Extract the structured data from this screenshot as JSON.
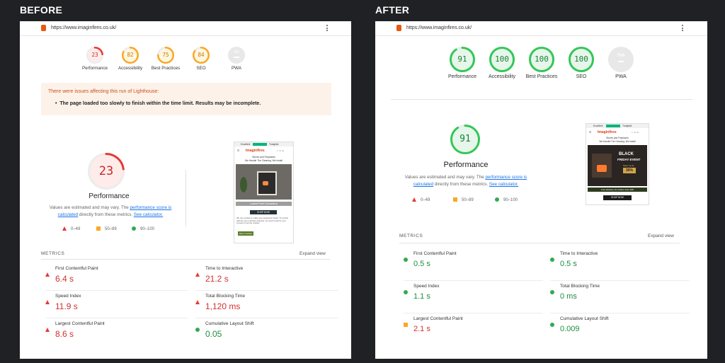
{
  "before": {
    "heading": "BEFORE",
    "url": "https://www.imaginfires.co.uk/",
    "gauges": [
      {
        "score": "23",
        "label": "Performance",
        "value": 23,
        "color": "#e53935",
        "fill": "#fdecea"
      },
      {
        "score": "82",
        "label": "Accessibility",
        "value": 82,
        "color": "#f9a825",
        "fill": "#fff6e0"
      },
      {
        "score": "75",
        "label": "Best Practices",
        "value": 75,
        "color": "#f9a825",
        "fill": "#fff6e0"
      },
      {
        "score": "84",
        "label": "SEO",
        "value": 84,
        "color": "#f9a825",
        "fill": "#fff6e0"
      },
      {
        "score": "PWA",
        "label": "PWA",
        "value": 0,
        "color": "#bdbdbd",
        "fill": "#e8e8e8"
      }
    ],
    "warning_title": "There were issues affecting this run of Lighthouse:",
    "warning_item": "The page loaded too slowly to finish within the time limit. Results may be incomplete.",
    "perf_score": "23",
    "perf_value": 23,
    "perf_title": "Performance",
    "desc_1": "Values are estimated and may vary. The ",
    "desc_link1": "performance score is calculated",
    "desc_2": " directly from these metrics. ",
    "desc_link2": "See calculator.",
    "legend": [
      "0–49",
      "50–89",
      "90–100"
    ],
    "metrics_title": "METRICS",
    "expand_label": "Expand view",
    "metrics": [
      {
        "name": "First Contentful Paint",
        "value": "6.4 s",
        "status": "fail"
      },
      {
        "name": "Time to Interactive",
        "value": "21.2 s",
        "status": "fail"
      },
      {
        "name": "Speed Index",
        "value": "11.9 s",
        "status": "fail"
      },
      {
        "name": "Total Blocking Time",
        "value": "1,120 ms",
        "status": "fail"
      },
      {
        "name": "Largest Contentful Paint",
        "value": "8.6 s",
        "status": "fail"
      },
      {
        "name": "Cumulative Layout Shift",
        "value": "0.05",
        "status": "pass"
      }
    ],
    "shot": {
      "rating": "Excellent",
      "trustpilot": "Trustpilot",
      "brand": "Imaginfires",
      "tagline1": "Stoves and Fireplaces",
      "tagline2": "We Handle The Cleaning, We Install",
      "cta": "Lowest Prices Guaranteed",
      "shop": "SHOP NOW",
      "cookie": "We use cookies to make your experience better. To comply with the new e-Privacy directive, we need to ask for your consent to set the cookies.",
      "cookie_btn": "Allow Cookies"
    }
  },
  "after": {
    "heading": "AFTER",
    "url": "https://www.imaginfires.co.uk/",
    "gauges": [
      {
        "score": "91",
        "label": "Performance",
        "value": 91,
        "color": "#34c759",
        "fill": "#e6f6ea"
      },
      {
        "score": "100",
        "label": "Accessibility",
        "value": 100,
        "color": "#34c759",
        "fill": "#e6f6ea"
      },
      {
        "score": "100",
        "label": "Best Practices",
        "value": 100,
        "color": "#34c759",
        "fill": "#e6f6ea"
      },
      {
        "score": "100",
        "label": "SEO",
        "value": 100,
        "color": "#34c759",
        "fill": "#e6f6ea"
      },
      {
        "score": "PWA",
        "label": "PWA",
        "value": 0,
        "color": "#bdbdbd",
        "fill": "#e8e8e8"
      }
    ],
    "perf_score": "91",
    "perf_value": 91,
    "perf_title": "Performance",
    "desc_1": "Values are estimated and may vary. The ",
    "desc_link1": "performance score is calculated",
    "desc_2": " directly from these metrics. ",
    "desc_link2": "See calculator.",
    "legend": [
      "0–49",
      "50–89",
      "90–100"
    ],
    "metrics_title": "METRICS",
    "expand_label": "Expand view",
    "metrics": [
      {
        "name": "First Contentful Paint",
        "value": "0.5 s",
        "status": "pass"
      },
      {
        "name": "Time to Interactive",
        "value": "0.5 s",
        "status": "pass"
      },
      {
        "name": "Speed Index",
        "value": "1.1 s",
        "status": "pass"
      },
      {
        "name": "Total Blocking Time",
        "value": "0 ms",
        "status": "pass"
      },
      {
        "name": "Largest Contentful Paint",
        "value": "2.1 s",
        "status": "average"
      },
      {
        "name": "Cumulative Layout Shift",
        "value": "0.009",
        "status": "pass"
      }
    ],
    "shot": {
      "rating": "Excellent",
      "trustpilot": "Trustpilot",
      "brand": "Imaginfires",
      "tagline1": "Stoves and Fireplaces",
      "tagline2": "We Handle The Cleaning, We Install",
      "bf1": "BLACK",
      "bf2": "FRIDAY EVENT",
      "bf3": "Save Up To",
      "bf4": "30%",
      "delivery": "Free Delivery On Orders Over £99",
      "shop": "SHOP NOW"
    }
  }
}
